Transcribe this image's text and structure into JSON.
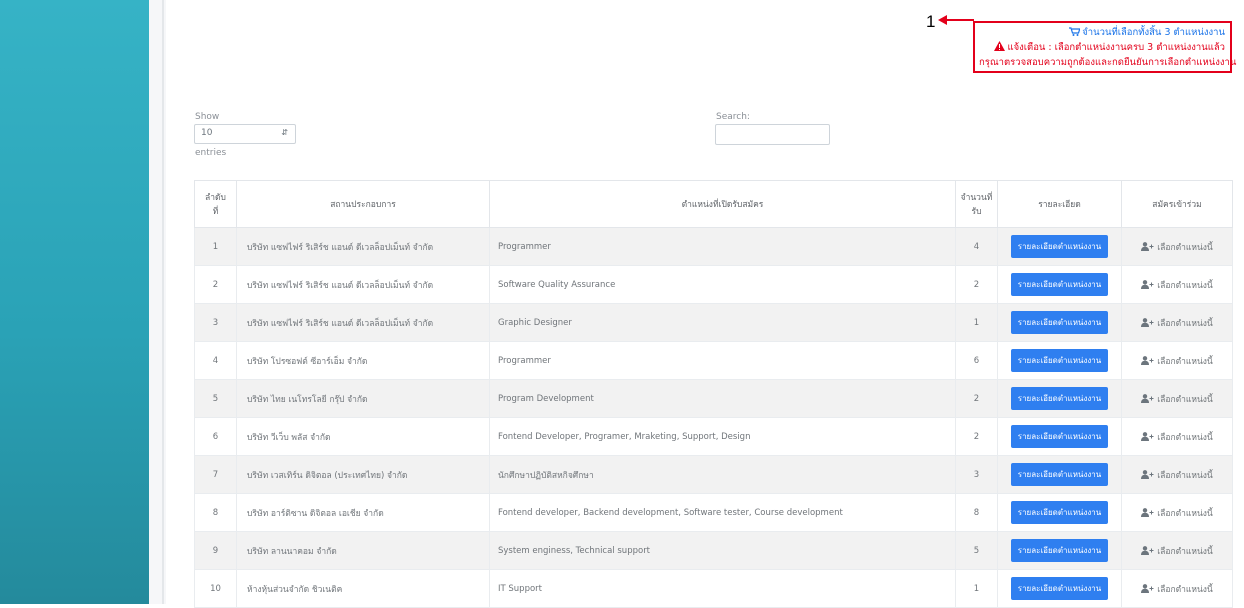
{
  "annotation": {
    "number": "1"
  },
  "alert": {
    "cart_line": "จำนวนที่เลือกทั้งสิ้น 3 ตำแหน่งงาน",
    "warning_line": "แจ้งเตือน : เลือกตำแหน่งงานครบ 3 ตำแหน่งงานแล้ว",
    "confirm_line": "กรุณาตรวจสอบความถูกต้องและกดยืนยันการเลือกตำแหน่งงาน",
    "colors": {
      "border": "#e3001b",
      "cart_text": "#1a73e8",
      "warning_text": "#e3001b"
    },
    "icons": [
      "cart-icon",
      "warning-icon"
    ]
  },
  "length_menu": {
    "show_label": "Show",
    "value": "10",
    "entries_label": "entries"
  },
  "search": {
    "label": "Search:",
    "value": ""
  },
  "table": {
    "headers": {
      "no_1": "ลำดับ",
      "no_2": "ที่",
      "company": "สถานประกอบการ",
      "position": "ตำแหน่งที่เปิดรับสมัคร",
      "count_1": "จำนวนที่",
      "count_2": "รับ",
      "detail": "รายละเอียด",
      "apply": "สมัครเข้าร่วม"
    },
    "detail_button": "รายละเอียดตำแหน่งงาน",
    "apply_label": "เลือกตำแหน่งนี้",
    "rows": [
      {
        "no": "1",
        "company": "บริษัท แซฟไฟร์ ริเสิร์ช แอนด์ ดีเวลล็อปเม็นท์ จำกัด",
        "position": "Programmer",
        "count": "4"
      },
      {
        "no": "2",
        "company": "บริษัท แซฟไฟร์ ริเสิร์ช แอนด์ ดีเวลล็อปเม็นท์ จำกัด",
        "position": "Software Quality Assurance",
        "count": "2"
      },
      {
        "no": "3",
        "company": "บริษัท แซฟไฟร์ ริเสิร์ช แอนด์ ดีเวลล็อปเม็นท์ จำกัด",
        "position": "Graphic Designer",
        "count": "1"
      },
      {
        "no": "4",
        "company": "บริษัท โปรซอฟต์ ซีอาร์เอ็ม จำกัด",
        "position": "Programmer",
        "count": "6"
      },
      {
        "no": "5",
        "company": "บริษัท ไทย เนโทรโลยี กรุ๊ป จำกัด",
        "position": "Program Development",
        "count": "2"
      },
      {
        "no": "6",
        "company": "บริษัท วีเว็บ พลัส จำกัด",
        "position": "Fontend Developer, Programer, Mraketing, Support, Design",
        "count": "2"
      },
      {
        "no": "7",
        "company": "บริษัท เวสเทิร์น ดิจิตอล (ประเทศไทย) จำกัด",
        "position": "นักศึกษาปฏิบัติสหกิจศึกษา",
        "count": "3"
      },
      {
        "no": "8",
        "company": "บริษัท อาร์ติซาน ดิจิตอล เอเชีย จำกัด",
        "position": "Fontend developer, Backend development, Software tester, Course development",
        "count": "8"
      },
      {
        "no": "9",
        "company": "บริษัท ลานนาคอม จำกัด",
        "position": "System enginess, Technical support",
        "count": "5"
      },
      {
        "no": "10",
        "company": "ห้างหุ้นส่วนจำกัด ชิวเนติค",
        "position": "IT Support",
        "count": "1"
      }
    ]
  },
  "colors": {
    "sidebar": "#2aa2b6",
    "button": "#2f7ff0",
    "striped_row": "#f2f2f2"
  }
}
